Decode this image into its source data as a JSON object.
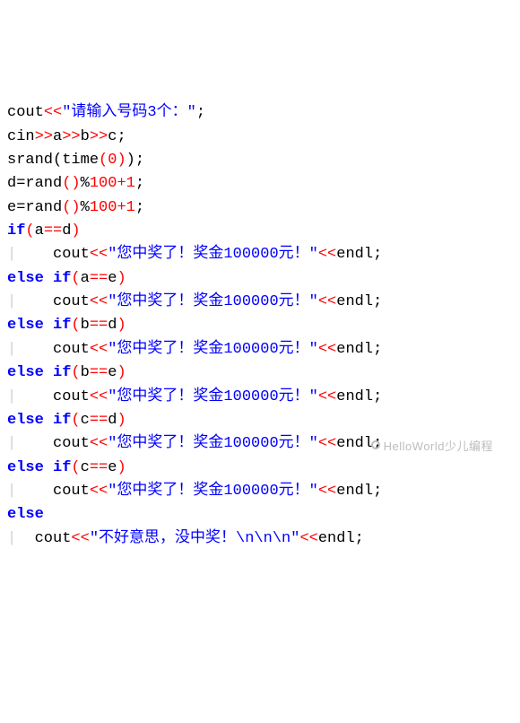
{
  "code": {
    "cout": "cout",
    "cin": "cin",
    "srand": "srand",
    "time": "time",
    "rand": "rand",
    "endl": "endl",
    "a": "a",
    "b": "b",
    "c": "c",
    "d": "d",
    "e": "e",
    "lt2": "<<",
    "gt2": ">>",
    "eqeq": "==",
    "eq": "=",
    "pct": "%",
    "plus": "+",
    "semi": ";",
    "lp": "(",
    "rp": ")",
    "n0": "0",
    "n1": "1",
    "n100": "100",
    "kw_if": "if",
    "kw_else": "else",
    "str_prompt": "\"请输入号码3个：\"",
    "str_win": "\"您中奖了！奖金100000元！\"",
    "str_lose": "\"不好意思，没中奖！\\n\\n\\n\"",
    "guide": "|",
    "indent": "    "
  },
  "watermark": "HelloWorld少儿编程"
}
